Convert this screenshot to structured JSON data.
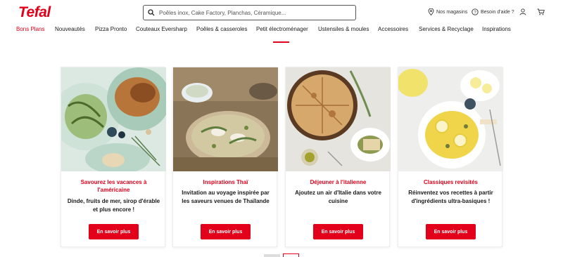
{
  "brand": {
    "logo": "Tefal",
    "color": "#e2001a"
  },
  "search": {
    "placeholder": "Poêles inox, Cake Factory, Planchas, Céramique..."
  },
  "utility": {
    "stores": "Nos magasins",
    "help": "Besoin d'aide ?"
  },
  "nav": {
    "items": [
      {
        "label": "Bons Plans",
        "active": true
      },
      {
        "label": "Nouveautés"
      },
      {
        "label": "Pizza Pronto"
      },
      {
        "label": "Couteaux Eversharp"
      },
      {
        "label": "Poêles & casseroles"
      },
      {
        "label": "Petit électroménager"
      },
      {
        "label": "Ustensiles & moules"
      },
      {
        "label": "Accessoires"
      },
      {
        "label": "Services & Recyclage"
      },
      {
        "label": "Inspirations"
      }
    ]
  },
  "cards": [
    {
      "title": "Savourez les vacances à l'américaine",
      "description": "Dinde, fruits de mer, sirop d'érable et plus encore !",
      "button": "En savoir plus",
      "image": "roast-turkey-green-beans"
    },
    {
      "title": "Inspirations Thaï",
      "description": "Invitation au voyage inspirée par les saveurs venues de Thaïlande",
      "button": "En savoir plus",
      "image": "thai-soup-bowl"
    },
    {
      "title": "Déjeuner à l'italienne",
      "description": "Ajoutez un air d'Italie dans votre cuisine",
      "button": "En savoir plus",
      "image": "italian-flatbread"
    },
    {
      "title": "Classiques revisités",
      "description": "Réinventez vos recettes à partir d'ingrédients ultra-basiques !",
      "button": "En savoir plus",
      "image": "saffron-rice-lemon"
    }
  ]
}
